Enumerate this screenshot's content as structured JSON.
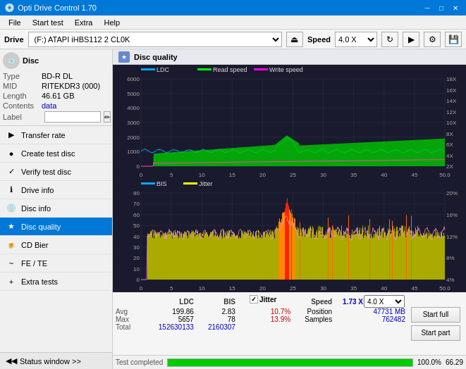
{
  "titleBar": {
    "title": "Opti Drive Control 1.70",
    "minBtn": "─",
    "maxBtn": "□",
    "closeBtn": "✕"
  },
  "menuBar": {
    "items": [
      "File",
      "Start test",
      "Extra",
      "Help"
    ]
  },
  "driveBar": {
    "label": "Drive",
    "driveValue": "(F:)  ATAPI iHBS112  2 CL0K",
    "speedLabel": "Speed",
    "speedValue": "4.0 X"
  },
  "sidebar": {
    "discSection": {
      "typeLabel": "Type",
      "typeVal": "BD-R DL",
      "midLabel": "MID",
      "midVal": "RITEKDR3 (000)",
      "lengthLabel": "Length",
      "lengthVal": "46.61 GB",
      "contentsLabel": "Contents",
      "contentsVal": "data",
      "labelLabel": "Label"
    },
    "navItems": [
      {
        "id": "transfer-rate",
        "label": "Transfer rate",
        "icon": "▶"
      },
      {
        "id": "create-test-disc",
        "label": "Create test disc",
        "icon": "●"
      },
      {
        "id": "verify-test-disc",
        "label": "Verify test disc",
        "icon": "✓"
      },
      {
        "id": "drive-info",
        "label": "Drive info",
        "icon": "ℹ"
      },
      {
        "id": "disc-info",
        "label": "Disc info",
        "icon": "📀"
      },
      {
        "id": "disc-quality",
        "label": "Disc quality",
        "icon": "★",
        "active": true
      },
      {
        "id": "cd-bier",
        "label": "CD Bier",
        "icon": "🍺"
      },
      {
        "id": "fe-te",
        "label": "FE / TE",
        "icon": "~"
      },
      {
        "id": "extra-tests",
        "label": "Extra tests",
        "icon": "+"
      }
    ],
    "statusWindow": "Status window >>",
    "statusWindowIcon": "◀"
  },
  "discQuality": {
    "title": "Disc quality",
    "icon": "★"
  },
  "chart1": {
    "legend": [
      "LDC",
      "Read speed",
      "Write speed"
    ],
    "yLeftMax": 6000,
    "yRightMax": 18,
    "xMax": 50
  },
  "chart2": {
    "legend": [
      "BIS",
      "Jitter"
    ],
    "yLeftMax": 80,
    "yRightMax": 20,
    "xMax": 50
  },
  "stats": {
    "columns": [
      "LDC",
      "BIS",
      "",
      "Jitter",
      "Speed",
      "1.73 X",
      "",
      "4.0 X"
    ],
    "rows": [
      {
        "label": "Avg",
        "ldc": "199.86",
        "bis": "2.83",
        "jitter": "10.7%"
      },
      {
        "label": "Max",
        "ldc": "5657",
        "bis": "78",
        "jitter": "13.9%"
      },
      {
        "label": "Total",
        "ldc": "152630133",
        "bis": "2160307",
        "jitter": ""
      }
    ],
    "jitterLabel": "Jitter",
    "speedLabel": "Speed",
    "speedVal": "1.73 X",
    "speedSelectVal": "4.0 X",
    "positionLabel": "Position",
    "positionVal": "47731 MB",
    "samplesLabel": "Samples",
    "samplesVal": "762482",
    "startFullBtn": "Start full",
    "startPartBtn": "Start part"
  },
  "statusBar": {
    "statusText": "Test completed",
    "progressPercent": 100,
    "progressText": "100.0%",
    "rightVal": "66.29"
  }
}
